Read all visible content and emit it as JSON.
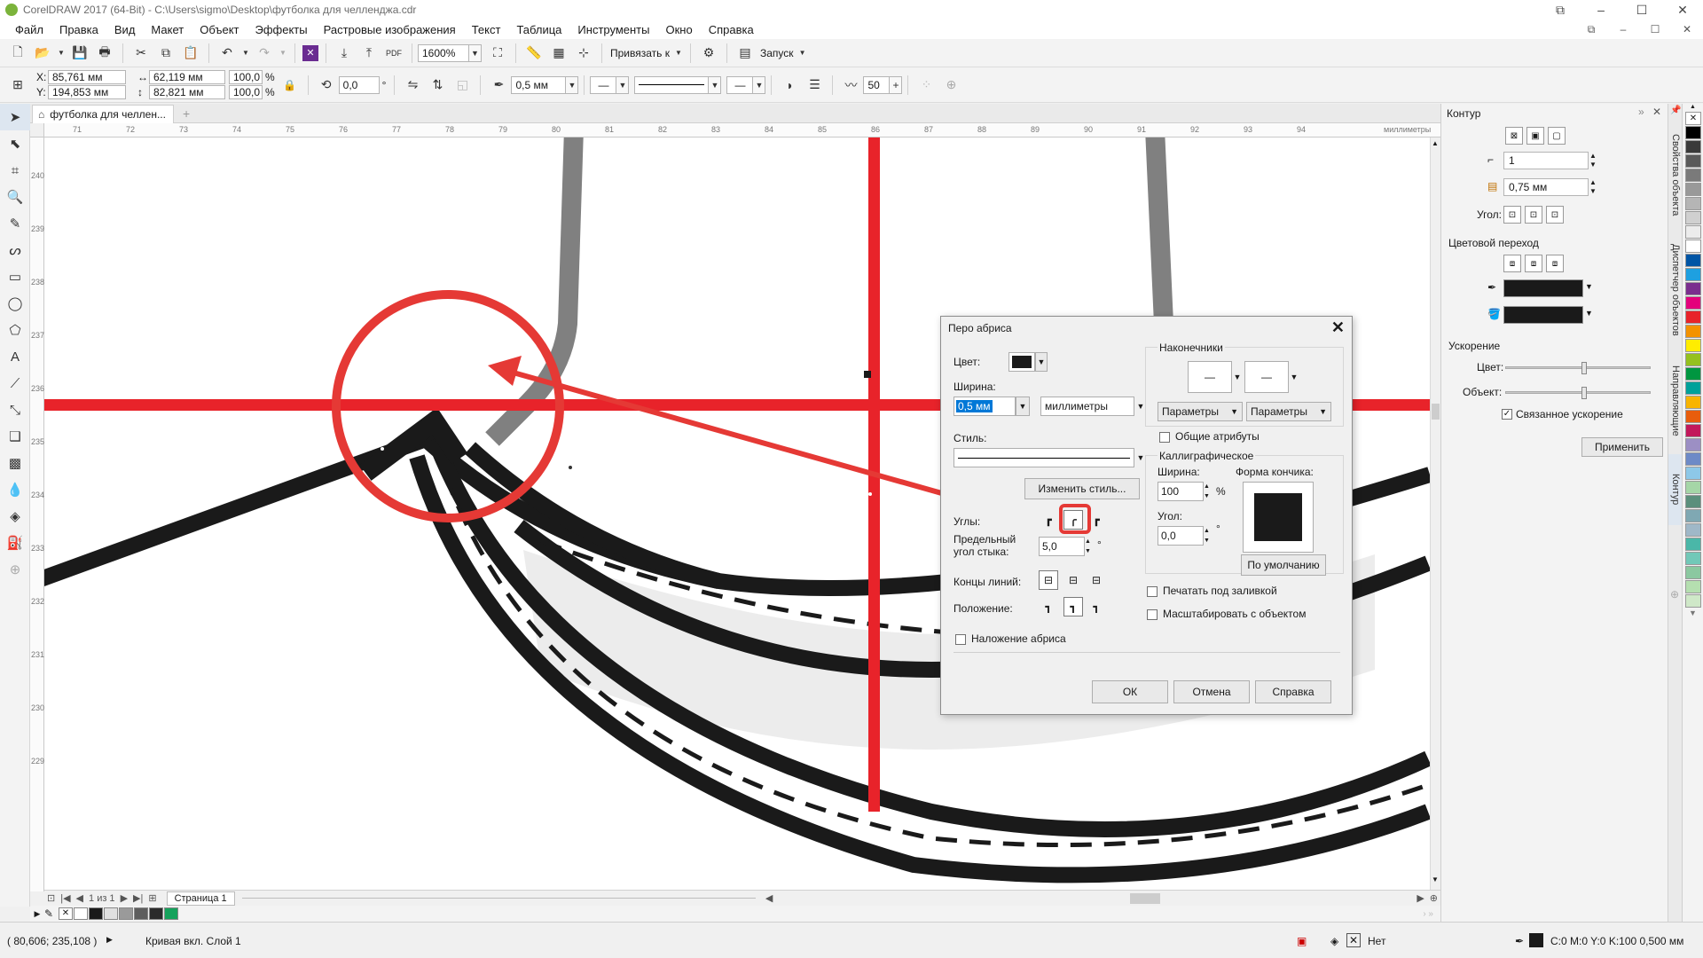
{
  "window": {
    "title": "CorelDRAW 2017 (64-Bit) - C:\\Users\\sigmo\\Desktop\\футболка для челленджа.cdr"
  },
  "menu": [
    "Файл",
    "Правка",
    "Вид",
    "Макет",
    "Объект",
    "Эффекты",
    "Растровые изображения",
    "Текст",
    "Таблица",
    "Инструменты",
    "Окно",
    "Справка"
  ],
  "toolbar1": {
    "zoom": "1600%",
    "snap_label": "Привязать к",
    "launch_label": "Запуск",
    "pdf_label": "PDF"
  },
  "toolbar2": {
    "x_label": "X:",
    "x": "85,761 мм",
    "y_label": "Y:",
    "y": "194,853 мм",
    "w": "62,119 мм",
    "h": "82,821 мм",
    "sx": "100,0",
    "sy": "100,0",
    "pct": "%",
    "angle": "0,0",
    "deg": "°",
    "outline_width": "0,5 мм",
    "smooth": "50"
  },
  "doc_tab": "футболка для челлен...",
  "ruler": {
    "h_ticks": [
      "71",
      "72",
      "73",
      "74",
      "75",
      "76",
      "77",
      "78",
      "79",
      "80",
      "81",
      "82",
      "83",
      "84",
      "85",
      "86",
      "87",
      "88",
      "89",
      "90",
      "91",
      "92",
      "93",
      "94"
    ],
    "h_unit": "миллиметры",
    "v_ticks": [
      "240",
      "239",
      "238",
      "237",
      "236",
      "235",
      "234",
      "233",
      "232",
      "231",
      "230",
      "229"
    ]
  },
  "page_nav": {
    "counter": "1 из 1",
    "page_tab": "Страница 1"
  },
  "status": {
    "coords": "( 80,606; 235,108 )",
    "object": "Кривая вкл. Слой 1",
    "fill": "Нет",
    "outline": "C:0 M:0 Y:0 K:100  0,500 мм"
  },
  "docker": {
    "title": "Контур",
    "width_value": "1",
    "outline_value": "0,75 мм",
    "angle_label": "Угол:",
    "blend_title": "Цветовой переход",
    "accel_title": "Ускорение",
    "color_label": "Цвет:",
    "object_label": "Объект:",
    "linked_label": "Связанное ускорение",
    "apply_label": "Применить"
  },
  "side_tabs": [
    "Свойства объекта",
    "Диспетчер объектов",
    "Направляющие",
    "Контур"
  ],
  "dialog": {
    "title": "Перо абриса",
    "color_label": "Цвет:",
    "width_label": "Ширина:",
    "width_value": "0,5 мм",
    "units": "миллиметры",
    "style_label": "Стиль:",
    "edit_style": "Изменить стиль...",
    "corners_label": "Углы:",
    "miter_label": "Предельный угол стыка:",
    "miter_value": "5,0",
    "caps_label": "Концы линий:",
    "position_label": "Положение:",
    "overprint_label": "Наложение абриса",
    "arrows_title": "Наконечники",
    "params1": "Параметры",
    "params2": "Параметры",
    "shared_label": "Общие атрибуты",
    "callig_title": "Каллиграфическое",
    "callig_width_label": "Ширина:",
    "callig_width": "100",
    "pct": "%",
    "nib_label": "Форма кончика:",
    "callig_angle_label": "Угол:",
    "callig_angle": "0,0",
    "default_btn": "По умолчанию",
    "behind_fill": "Печатать под заливкой",
    "scale_obj": "Масштабировать с объектом",
    "ok": "ОК",
    "cancel": "Отмена",
    "help": "Справка"
  },
  "colors": {
    "accent_red": "#e8232a",
    "annotation_red": "#e53935",
    "grey_line": "#808080",
    "black": "#1a1a1a"
  }
}
